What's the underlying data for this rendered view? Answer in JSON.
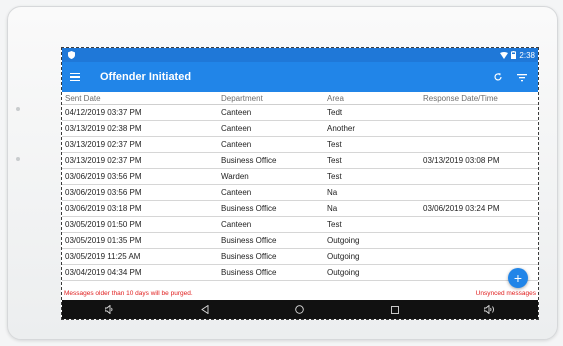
{
  "status": {
    "time": "2:38"
  },
  "app": {
    "title": "Offender Initiated"
  },
  "table": {
    "columns": [
      "Sent Date",
      "Department",
      "Area",
      "Response Date/Time"
    ],
    "rows": [
      [
        "04/12/2019 03:37 PM",
        "Canteen",
        "Tedt",
        ""
      ],
      [
        "03/13/2019 02:38 PM",
        "Canteen",
        "Another",
        ""
      ],
      [
        "03/13/2019 02:37 PM",
        "Canteen",
        "Test",
        ""
      ],
      [
        "03/13/2019 02:37 PM",
        "Business Office",
        "Test",
        "03/13/2019 03:08 PM"
      ],
      [
        "03/06/2019 03:56 PM",
        "Warden",
        "Test",
        ""
      ],
      [
        "03/06/2019 03:56 PM",
        "Canteen",
        "Na",
        ""
      ],
      [
        "03/06/2019 03:18 PM",
        "Business Office",
        "Na",
        "03/06/2019 03:24 PM"
      ],
      [
        "03/05/2019 01:50 PM",
        "Canteen",
        "Test",
        ""
      ],
      [
        "03/05/2019 01:35 PM",
        "Business Office",
        "Outgoing",
        ""
      ],
      [
        "03/05/2019 11:25 AM",
        "Business Office",
        "Outgoing",
        ""
      ],
      [
        "03/04/2019 04:34 PM",
        "Business Office",
        "Outgoing",
        ""
      ]
    ]
  },
  "footer": {
    "purge_notice": "Messages older than 10 days will be purged.",
    "unsynced": "Unsynced messages"
  },
  "fab": {
    "label": "+"
  },
  "icons": {
    "menu": "hamburger-menu-icon",
    "refresh": "refresh-icon",
    "filter": "filter-icon"
  }
}
